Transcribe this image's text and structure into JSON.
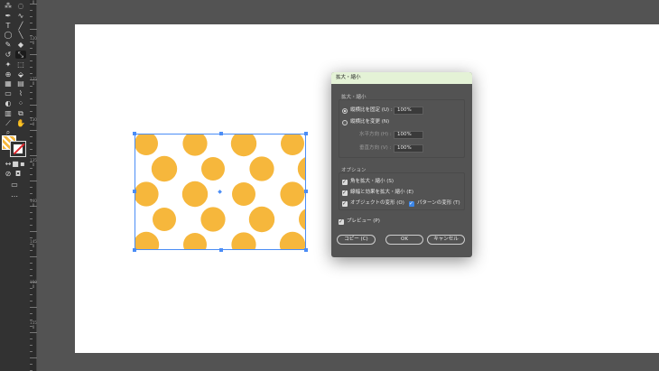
{
  "toolbar": {
    "tools": [
      {
        "name": "magic-wand-tool-icon",
        "glyph": "⁂"
      },
      {
        "name": "lasso-tool-icon",
        "glyph": "◌"
      },
      {
        "name": "pen-tool-icon",
        "glyph": "✒"
      },
      {
        "name": "curvature-tool-icon",
        "glyph": "∿"
      },
      {
        "name": "type-tool-icon",
        "glyph": "T"
      },
      {
        "name": "line-tool-icon",
        "glyph": "╱"
      },
      {
        "name": "ellipse-tool-icon",
        "glyph": "◯"
      },
      {
        "name": "paintbrush-tool-icon",
        "glyph": "╲"
      },
      {
        "name": "shaper-tool-icon",
        "glyph": "✎"
      },
      {
        "name": "eraser-tool-icon",
        "glyph": "◆"
      },
      {
        "name": "rotate-tool-icon",
        "glyph": "↺"
      },
      {
        "name": "scale-tool-icon",
        "glyph": "⤡"
      },
      {
        "name": "puppet-warp-tool-icon",
        "glyph": "✦"
      },
      {
        "name": "free-transform-tool-icon",
        "glyph": "⬚"
      },
      {
        "name": "shape-builder-tool-icon",
        "glyph": "⊕"
      },
      {
        "name": "live-paint-tool-icon",
        "glyph": "⬙"
      },
      {
        "name": "perspective-grid-tool-icon",
        "glyph": "▦"
      },
      {
        "name": "mesh-tool-icon",
        "glyph": "▤"
      },
      {
        "name": "gradient-tool-icon",
        "glyph": "▭"
      },
      {
        "name": "eyedropper-tool-icon",
        "glyph": "⌇"
      },
      {
        "name": "blend-tool-icon",
        "glyph": "◐"
      },
      {
        "name": "symbol-sprayer-tool-icon",
        "glyph": "⁘"
      },
      {
        "name": "column-graph-tool-icon",
        "glyph": "▥"
      },
      {
        "name": "artboard-tool-icon",
        "glyph": "⧉"
      },
      {
        "name": "slice-tool-icon",
        "glyph": "⟋"
      },
      {
        "name": "hand-tool-icon",
        "glyph": "✋"
      },
      {
        "name": "zoom-tool-icon",
        "glyph": "⌕"
      },
      {
        "name": "swap-colors-icon",
        "glyph": "↔"
      },
      {
        "name": "color-mode-icon",
        "glyph": "■"
      },
      {
        "name": "gradient-mode-icon",
        "glyph": "▪"
      },
      {
        "name": "none-mode-icon",
        "glyph": "⊘"
      },
      {
        "name": "draw-normal-icon",
        "glyph": "◘"
      },
      {
        "name": "screen-mode-icon",
        "glyph": "▭"
      },
      {
        "name": "more-tools-icon",
        "glyph": "⋯"
      }
    ]
  },
  "ruler": {
    "labels": [
      "1150",
      "1200",
      "1250",
      "1300",
      "1350",
      "1400",
      "1450",
      "1500",
      "1550"
    ]
  },
  "artwork": {
    "dot_color": "#f6b73c",
    "bbox_color": "#4b8df6"
  },
  "dialog": {
    "title": "拡大・縮小",
    "scale_section_label": "拡大・縮小",
    "uniform_label": "縦横比を固定 (U) :",
    "uniform_value": "100%",
    "non_uniform_label": "縦横比を変更 (N)",
    "horizontal_label": "水平方向 (H) :",
    "horizontal_value": "100%",
    "vertical_label": "垂直方向 (V) :",
    "vertical_value": "100%",
    "options_label": "オプション",
    "scale_corners_label": "角を拡大・縮小 (S)",
    "scale_strokes_label": "線幅と効果を拡大・縮小 (E)",
    "transform_objects_label": "オブジェクトの変形 (O)",
    "transform_patterns_label": "パターンの変形 (T)",
    "preview_label": "プレビュー (P)",
    "copy_button": "コピー (C)",
    "ok_button": "OK",
    "cancel_button": "キャンセル"
  }
}
